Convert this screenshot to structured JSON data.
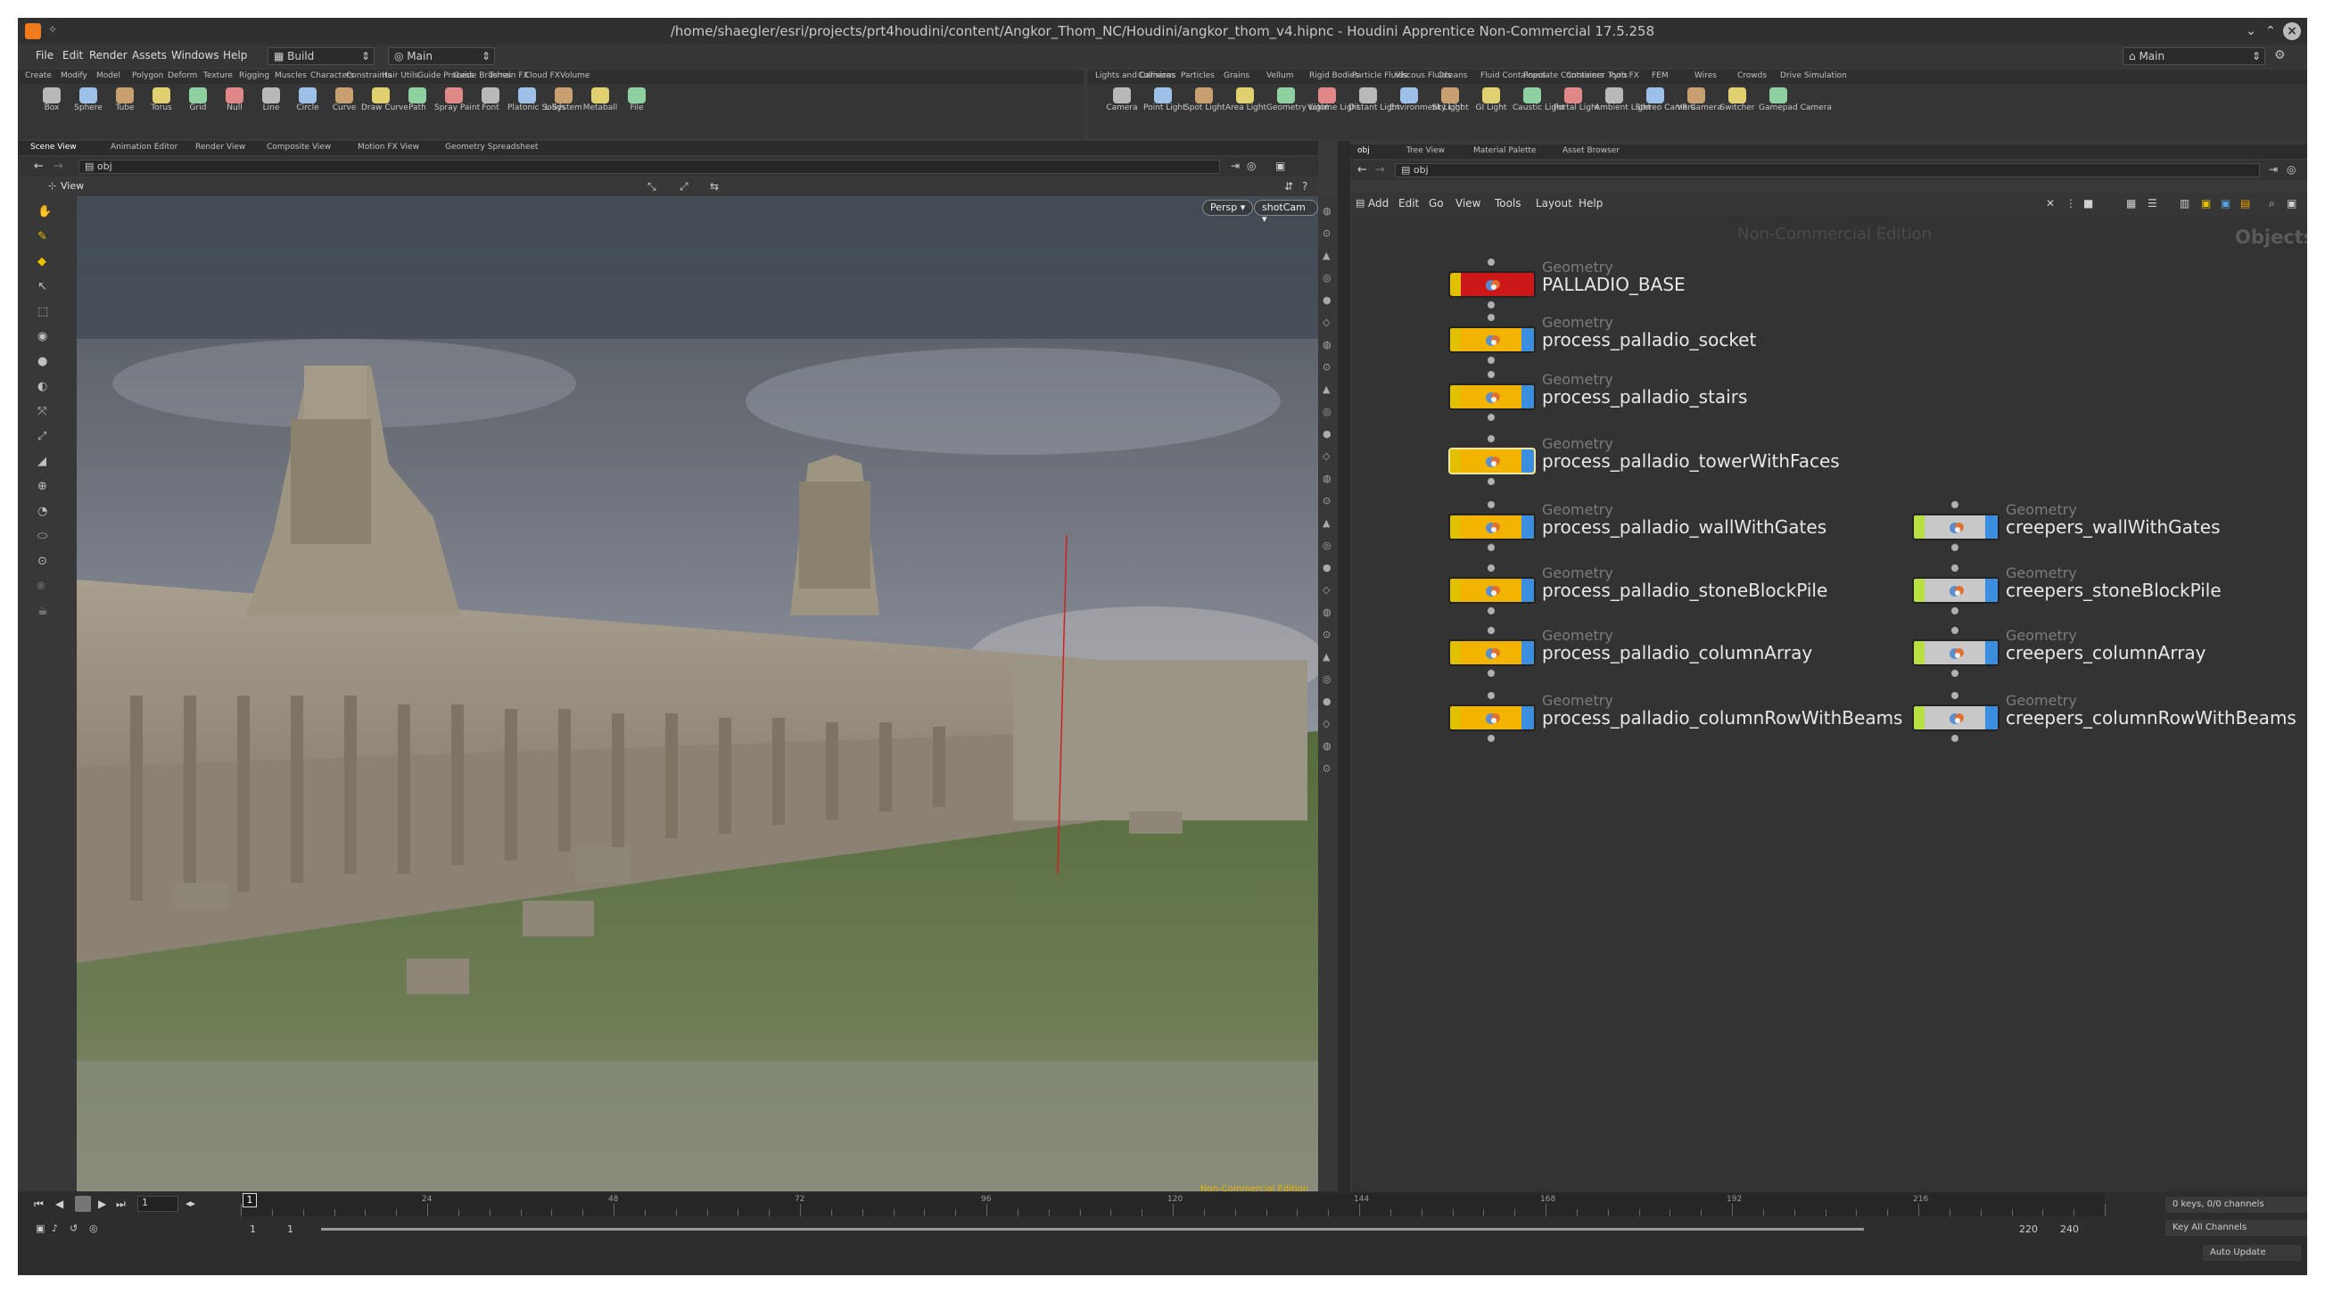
{
  "window": {
    "title": "/home/shaegler/esri/projects/prt4houdini/content/Angkor_Thom_NC/Houdini/angkor_thom_v4.hipnc - Houdini Apprentice Non-Commercial 17.5.258",
    "minimize": "⌄",
    "maximize": "⌃",
    "close": "×"
  },
  "menubar": {
    "items": [
      "File",
      "Edit",
      "Render",
      "Assets",
      "Windows",
      "Help"
    ],
    "desktop": "Build",
    "context": "Main",
    "right_context": "Main"
  },
  "shelf_left": {
    "tabs": [
      "Create",
      "Modify",
      "Model",
      "Polygon",
      "Deform",
      "Texture",
      "Rigging",
      "Muscles",
      "Characters",
      "Constraints",
      "Hair Utils",
      "Guide Process",
      "Guide Brushes",
      "Terrain FX",
      "Cloud FX",
      "Volume"
    ],
    "tools": [
      "Box",
      "Sphere",
      "Tube",
      "Torus",
      "Grid",
      "Null",
      "Line",
      "Circle",
      "Curve",
      "Draw Curve",
      "Path",
      "Spray Paint",
      "Font",
      "Platonic Solids",
      "L-System",
      "Metaball",
      "File"
    ]
  },
  "shelf_right": {
    "tabs": [
      "Lights and Cameras",
      "Collisions",
      "Particles",
      "Grains",
      "Vellum",
      "Rigid Bodies",
      "Particle Fluids",
      "Viscous Fluids",
      "Oceans",
      "Fluid Containers",
      "Populate Containers",
      "Container Tools",
      "Pyro FX",
      "FEM",
      "Wires",
      "Crowds",
      "Drive Simulation"
    ],
    "tools": [
      "Camera",
      "Point Light",
      "Spot Light",
      "Area Light",
      "Geometry Light",
      "Volume Light",
      "Distant Light",
      "Environment Light",
      "Sky Light",
      "GI Light",
      "Caustic Light",
      "Portal Light",
      "Ambient Light",
      "Stereo Camera",
      "VR Camera",
      "Switcher",
      "Gamepad Camera"
    ]
  },
  "left_pane": {
    "tabs": [
      "Scene View",
      "Animation Editor",
      "Render View",
      "Composite View",
      "Motion FX View",
      "Geometry Spreadsheet"
    ],
    "path": "obj",
    "view_label": "View",
    "persp": "Persp ▾",
    "camera": "shotCam ▾",
    "watermark": "Non-Commercial Edition"
  },
  "right_pane": {
    "tabs": [
      "obj",
      "Tree View",
      "Material Palette",
      "Asset Browser"
    ],
    "path": "obj",
    "menu": [
      "Add",
      "Edit",
      "Go",
      "View",
      "Tools",
      "Layout",
      "Help"
    ],
    "watermark": "Non-Commercial Edition",
    "context_label": "Objects"
  },
  "nodes": [
    {
      "kind": "Geometry",
      "name": "PALLADIO_BASE",
      "color": "#cc1818",
      "kind_color": "red"
    },
    {
      "kind": "Geometry",
      "name": "process_palladio_socket",
      "color": "#f2b400"
    },
    {
      "kind": "Geometry",
      "name": "process_palladio_stairs",
      "color": "#f2b400"
    },
    {
      "kind": "Geometry",
      "name": "process_palladio_towerWithFaces",
      "color": "#f2b400"
    },
    {
      "kind": "Geometry",
      "name": "process_palladio_wallWithGates",
      "color": "#f2b400"
    },
    {
      "kind": "Geometry",
      "name": "process_palladio_stoneBlockPile",
      "color": "#f2b400"
    },
    {
      "kind": "Geometry",
      "name": "process_palladio_columnArray",
      "color": "#f2b400"
    },
    {
      "kind": "Geometry",
      "name": "process_palladio_columnRowWithBeams",
      "color": "#f2b400"
    },
    {
      "kind": "Geometry",
      "name": "creepers_wallWithGates",
      "color": "#c8c8c8"
    },
    {
      "kind": "Geometry",
      "name": "creepers_stoneBlockPile",
      "color": "#c8c8c8"
    },
    {
      "kind": "Geometry",
      "name": "creepers_columnArray",
      "color": "#c8c8c8"
    },
    {
      "kind": "Geometry",
      "name": "creepers_columnRowWithBeams",
      "color": "#c8c8c8"
    }
  ],
  "timeline": {
    "ticks": [
      "24",
      "48",
      "72",
      "96",
      "120",
      "144",
      "168",
      "192",
      "216"
    ],
    "current_frame": "1",
    "frame_field": "1",
    "range_start": "1",
    "range_start2": "1",
    "range_end": "220",
    "range_end2": "240",
    "keys_label": "0 keys, 0/0 channels",
    "key_all": "Key All Channels",
    "auto_update": "Auto Update"
  },
  "colors": {
    "accent_orange": "#f07a1e",
    "node_yellow": "#f2b400",
    "node_red": "#cc1818",
    "node_blue": "#3b8de0"
  }
}
